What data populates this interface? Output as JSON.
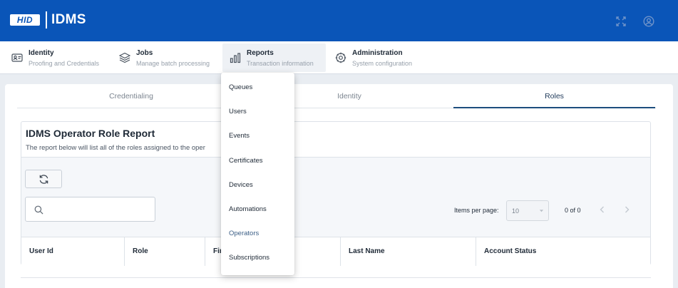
{
  "header": {
    "logo": "HID",
    "app_name": "IDMS",
    "icons": [
      "fullscreen-icon",
      "user-account-icon"
    ]
  },
  "nav": {
    "items": [
      {
        "title": "Identity",
        "subtitle": "Proofing and Credentials",
        "icon": "id-card-icon"
      },
      {
        "title": "Jobs",
        "subtitle": "Manage batch processing",
        "icon": "layers-icon"
      },
      {
        "title": "Reports",
        "subtitle": "Transaction information",
        "icon": "bar-chart-icon",
        "active": true
      },
      {
        "title": "Administration",
        "subtitle": "System configuration",
        "icon": "gear-icon"
      }
    ]
  },
  "tabs": [
    {
      "label": "Credentialing"
    },
    {
      "label": "Identity"
    },
    {
      "label": "Roles",
      "active": true
    }
  ],
  "report": {
    "title": "IDMS Operator Role Report",
    "description": "The report below will list all of the roles assigned to the oper",
    "search_placeholder": "",
    "items_per_page_label": "Items per page:",
    "items_per_page_value": "10",
    "range_label": "0 of 0",
    "columns": [
      "User Id",
      "Role",
      "Fir",
      "Last Name",
      "Account Status"
    ]
  },
  "reports_menu": {
    "items": [
      {
        "label": "Queues"
      },
      {
        "label": "Users"
      },
      {
        "label": "Events"
      },
      {
        "label": "Certificates"
      },
      {
        "label": "Devices"
      },
      {
        "label": "Automations"
      },
      {
        "label": "Operators",
        "active": true
      },
      {
        "label": "Subscriptions"
      }
    ]
  },
  "colors": {
    "header_bg": "#0a55b8",
    "tab_active_underline": "#1d4e7e",
    "menu_active_text": "#3c5f86"
  }
}
